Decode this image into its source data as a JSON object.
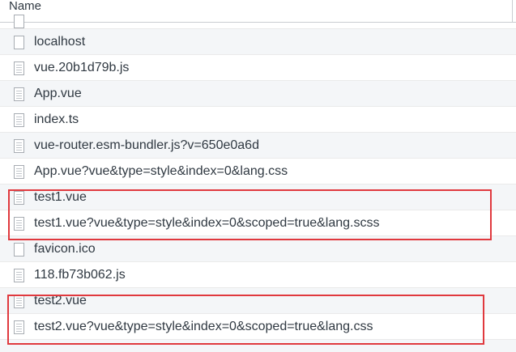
{
  "header": {
    "name_column_label": "Name"
  },
  "rows": [
    {
      "label": "localhost",
      "icon": "document-icon"
    },
    {
      "label": "vue.20b1d79b.js",
      "icon": "script-file-icon"
    },
    {
      "label": "App.vue",
      "icon": "script-file-icon"
    },
    {
      "label": "index.ts",
      "icon": "script-file-icon"
    },
    {
      "label": "vue-router.esm-bundler.js?v=650e0a6d",
      "icon": "script-file-icon"
    },
    {
      "label": "App.vue?vue&type=style&index=0&lang.css",
      "icon": "script-file-icon"
    },
    {
      "label": "test1.vue",
      "icon": "script-file-icon"
    },
    {
      "label": "test1.vue?vue&type=style&index=0&scoped=true&lang.scss",
      "icon": "script-file-icon"
    },
    {
      "label": "favicon.ico",
      "icon": "document-icon"
    },
    {
      "label": "118.fb73b062.js",
      "icon": "script-file-icon"
    },
    {
      "label": "test2.vue",
      "icon": "script-file-icon"
    },
    {
      "label": "test2.vue?vue&type=style&index=0&scoped=true&lang.css",
      "icon": "script-file-icon"
    }
  ],
  "annotation_color": "#e0393e"
}
